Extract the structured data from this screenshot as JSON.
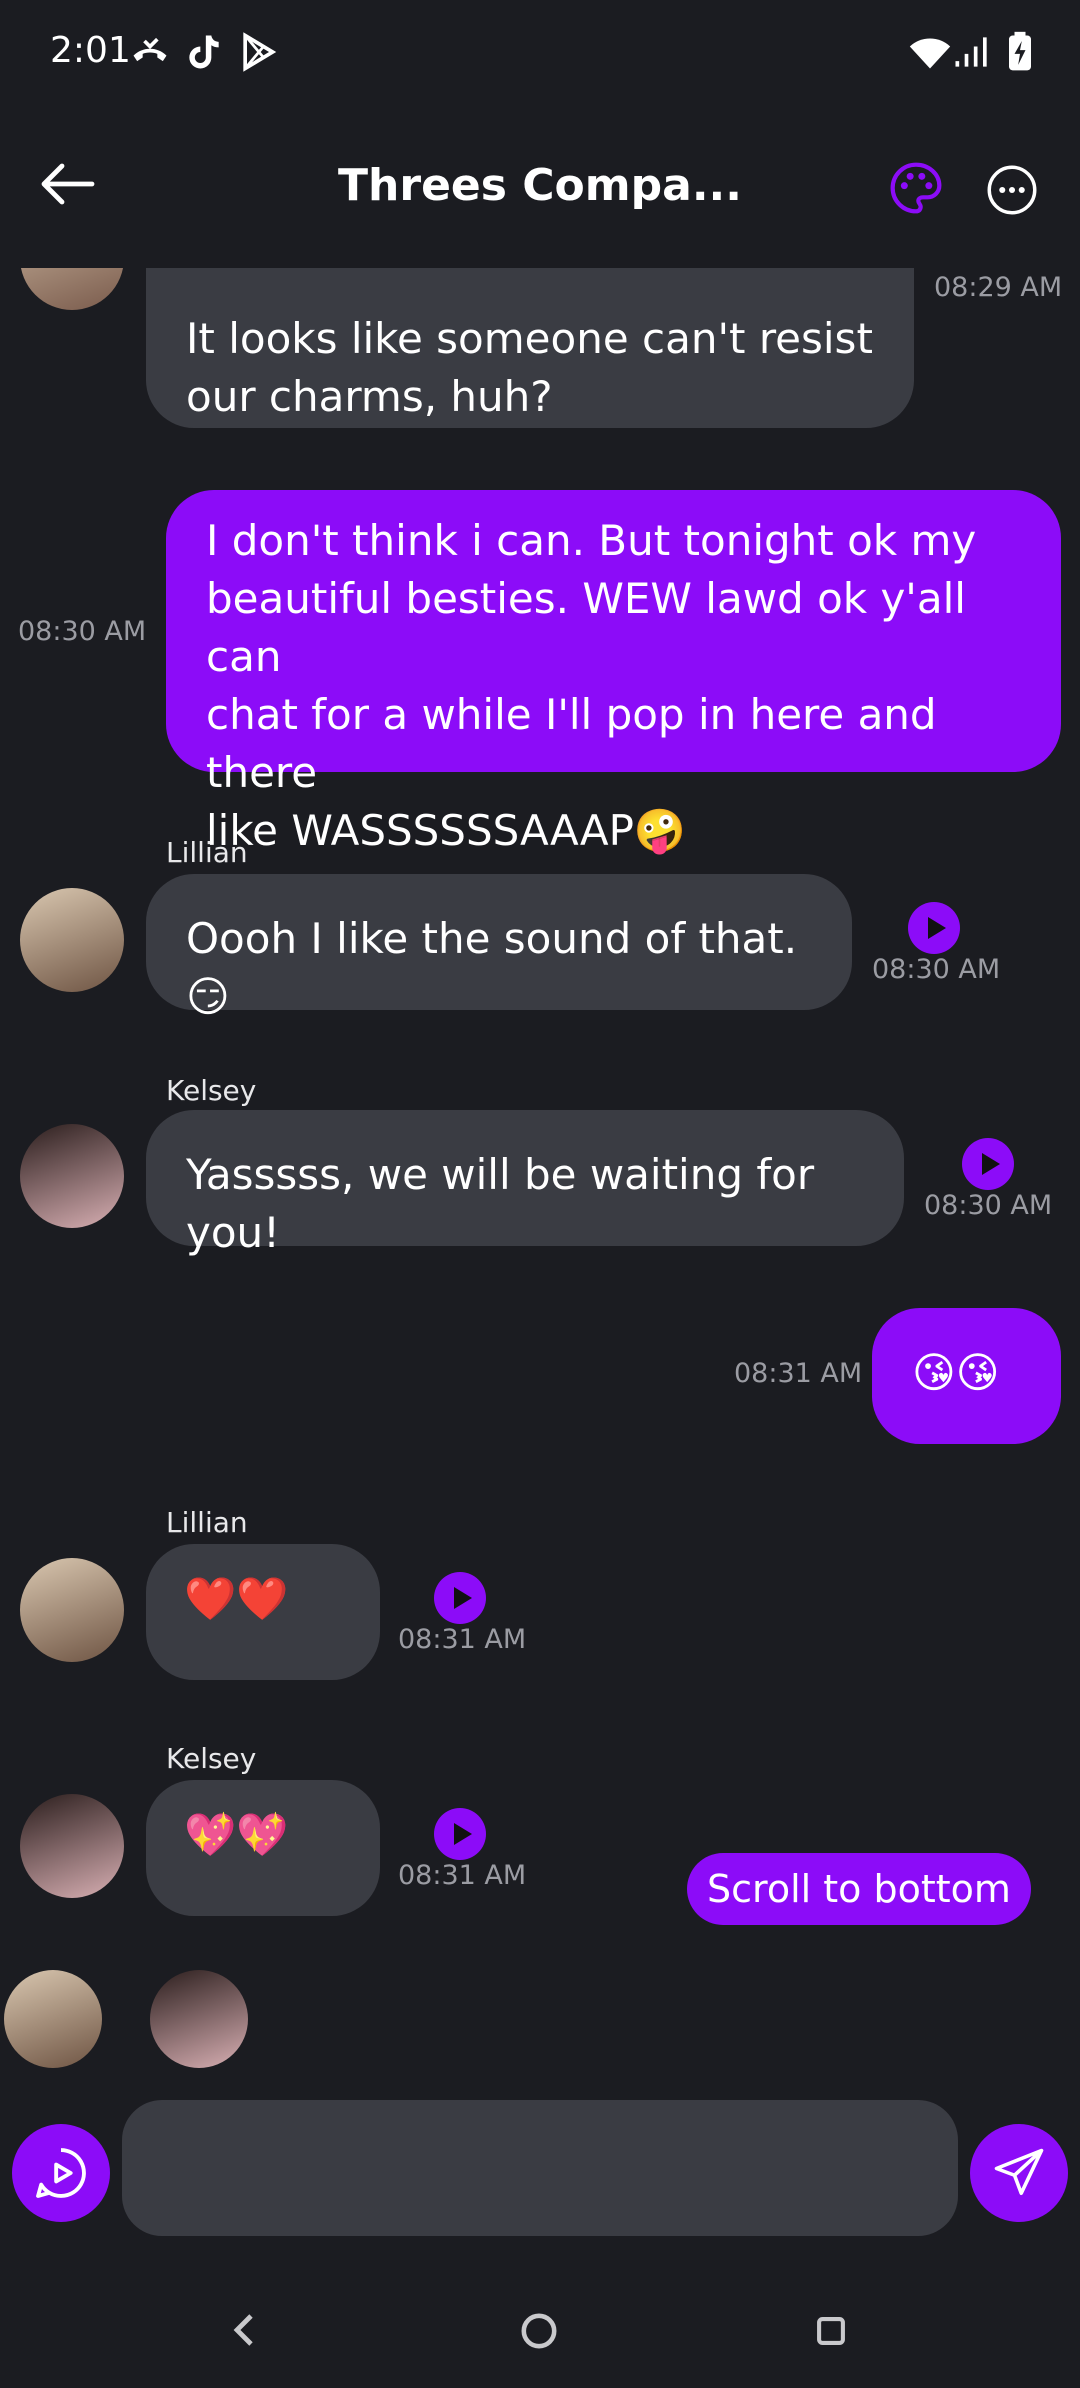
{
  "status_bar": {
    "time": "2:01"
  },
  "header": {
    "title": "Threes Compa..."
  },
  "messages": [
    {
      "sender": "",
      "direction": "in",
      "text": "It looks like someone can't resist\nour charms, huh?",
      "time": "08:29 AM",
      "avatar": "lillian"
    },
    {
      "sender": "",
      "direction": "out",
      "text": "I don't think i can. But tonight ok my\nbeautiful besties. WEW lawd ok y'all can\nchat for a while I'll pop in here and there\nlike WASSSSSSAAAP🤪",
      "time": "08:30 AM"
    },
    {
      "sender": "Lillian",
      "direction": "in",
      "text": "Oooh I like the sound of that. 😏",
      "time": "08:30 AM",
      "avatar": "lillian",
      "has_play": true
    },
    {
      "sender": "Kelsey",
      "direction": "in",
      "text": "Yasssss, we will be waiting for you!",
      "time": "08:30 AM",
      "avatar": "kelsey",
      "has_play": true
    },
    {
      "sender": "",
      "direction": "out",
      "text": "😘😘",
      "time": "08:31 AM"
    },
    {
      "sender": "Lillian",
      "direction": "in",
      "text": "❤️❤️",
      "time": "08:31 AM",
      "avatar": "lillian",
      "has_play": true
    },
    {
      "sender": "Kelsey",
      "direction": "in",
      "text": "💖💖",
      "time": "08:31 AM",
      "avatar": "kelsey",
      "has_play": true
    }
  ],
  "scroll_to_bottom_label": "Scroll to bottom",
  "composer": {
    "placeholder": ""
  },
  "colors": {
    "accent": "#8c0cf8",
    "background": "#1b1c21",
    "incoming_bubble": "#3a3c43"
  },
  "icons": {
    "back": "arrow-left-icon",
    "palette": "palette-icon",
    "more": "more-horizontal-icon",
    "voice": "voice-chat-icon",
    "send": "send-icon",
    "nav_back": "chevron-left-icon",
    "nav_home": "circle-home-icon",
    "nav_recents": "square-recents-icon"
  }
}
